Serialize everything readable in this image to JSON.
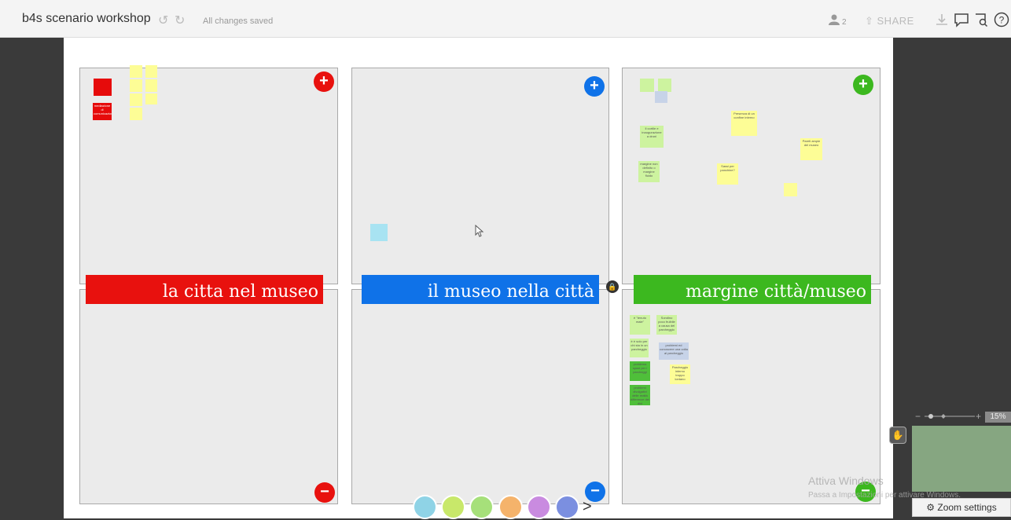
{
  "header": {
    "title": "b4s scenario workshop",
    "status": "All changes saved",
    "user_count": "2",
    "share_label": "SHARE",
    "undo_icon": "↺",
    "redo_icon": "↻"
  },
  "board": {
    "banners": [
      {
        "label": "la citta nel museo",
        "color": "#e8110e"
      },
      {
        "label": "il museo nella città",
        "color": "#0f72e8"
      },
      {
        "label": "margine città/museo",
        "color": "#3cb81f"
      }
    ],
    "notes_top_left": [
      {
        "text": "mediazione di comunicazione"
      }
    ],
    "notes_top_right": [
      {
        "text": "Presenza di un confine interno"
      },
      {
        "text": "Pareti ampie del museo"
      },
      {
        "text": "Sassi per panchine?"
      },
      {
        "text": "Il cortile e inaugurazione a droni"
      },
      {
        "text": "margine non definito o margine fluido"
      }
    ],
    "notes_bottom_right": [
      {
        "text": "è \"tenuto male\""
      },
      {
        "text": "Sondino poco fruibile a causa del parcheggio"
      },
      {
        "text": "è è solo per chi sta in un parcheggio"
      },
      {
        "text": "problemi ed conoscere una volta al parcheggio"
      },
      {
        "text": "Parcheggio interno troppo lontano"
      },
      {
        "text": "problema spazi per i parcheggi"
      },
      {
        "text": "problemi divulgativi delle realtà differenze dei divi"
      }
    ]
  },
  "zoom": {
    "percent": "15%",
    "settings_label": "Zoom settings",
    "settings_icon": "gear-icon"
  },
  "watermark": {
    "line1": "Attiva Windows",
    "line2": "Passa a Impostazioni per attivare Windows."
  },
  "avatars": [
    {
      "icon": "fish-icon",
      "color": "#8fd3e6"
    },
    {
      "icon": "robot-icon",
      "color": "#c8e86a"
    },
    {
      "icon": "bee-icon",
      "color": "#a6e07a"
    },
    {
      "icon": "cat-icon",
      "color": "#f5b36b"
    },
    {
      "icon": "shrimp-icon",
      "color": "#c98be0"
    },
    {
      "icon": "dolphin-icon",
      "color": "#7b8fe0"
    }
  ]
}
